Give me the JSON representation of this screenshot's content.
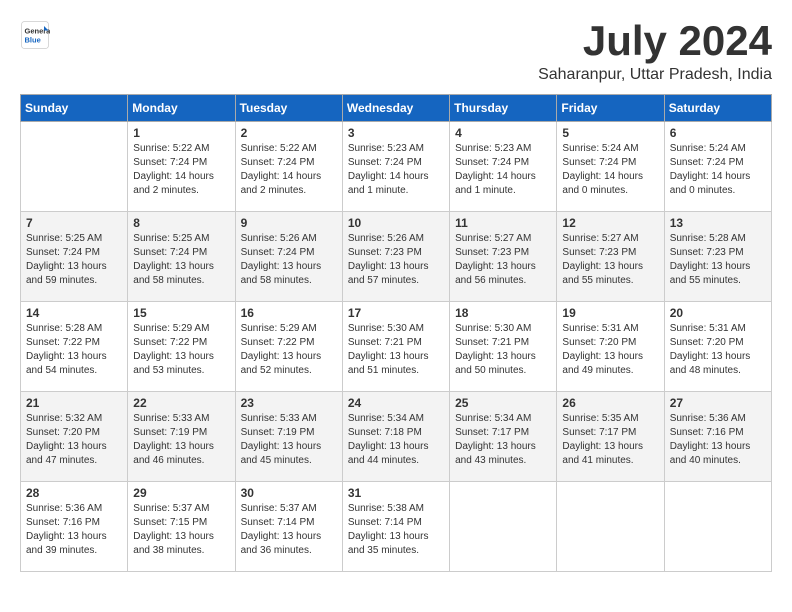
{
  "header": {
    "logo_general": "General",
    "logo_blue": "Blue",
    "month_title": "July 2024",
    "location": "Saharanpur, Uttar Pradesh, India"
  },
  "columns": [
    "Sunday",
    "Monday",
    "Tuesday",
    "Wednesday",
    "Thursday",
    "Friday",
    "Saturday"
  ],
  "weeks": [
    [
      {
        "day": "",
        "info": ""
      },
      {
        "day": "1",
        "info": "Sunrise: 5:22 AM\nSunset: 7:24 PM\nDaylight: 14 hours\nand 2 minutes."
      },
      {
        "day": "2",
        "info": "Sunrise: 5:22 AM\nSunset: 7:24 PM\nDaylight: 14 hours\nand 2 minutes."
      },
      {
        "day": "3",
        "info": "Sunrise: 5:23 AM\nSunset: 7:24 PM\nDaylight: 14 hours\nand 1 minute."
      },
      {
        "day": "4",
        "info": "Sunrise: 5:23 AM\nSunset: 7:24 PM\nDaylight: 14 hours\nand 1 minute."
      },
      {
        "day": "5",
        "info": "Sunrise: 5:24 AM\nSunset: 7:24 PM\nDaylight: 14 hours\nand 0 minutes."
      },
      {
        "day": "6",
        "info": "Sunrise: 5:24 AM\nSunset: 7:24 PM\nDaylight: 14 hours\nand 0 minutes."
      }
    ],
    [
      {
        "day": "7",
        "info": "Sunrise: 5:25 AM\nSunset: 7:24 PM\nDaylight: 13 hours\nand 59 minutes."
      },
      {
        "day": "8",
        "info": "Sunrise: 5:25 AM\nSunset: 7:24 PM\nDaylight: 13 hours\nand 58 minutes."
      },
      {
        "day": "9",
        "info": "Sunrise: 5:26 AM\nSunset: 7:24 PM\nDaylight: 13 hours\nand 58 minutes."
      },
      {
        "day": "10",
        "info": "Sunrise: 5:26 AM\nSunset: 7:23 PM\nDaylight: 13 hours\nand 57 minutes."
      },
      {
        "day": "11",
        "info": "Sunrise: 5:27 AM\nSunset: 7:23 PM\nDaylight: 13 hours\nand 56 minutes."
      },
      {
        "day": "12",
        "info": "Sunrise: 5:27 AM\nSunset: 7:23 PM\nDaylight: 13 hours\nand 55 minutes."
      },
      {
        "day": "13",
        "info": "Sunrise: 5:28 AM\nSunset: 7:23 PM\nDaylight: 13 hours\nand 55 minutes."
      }
    ],
    [
      {
        "day": "14",
        "info": "Sunrise: 5:28 AM\nSunset: 7:22 PM\nDaylight: 13 hours\nand 54 minutes."
      },
      {
        "day": "15",
        "info": "Sunrise: 5:29 AM\nSunset: 7:22 PM\nDaylight: 13 hours\nand 53 minutes."
      },
      {
        "day": "16",
        "info": "Sunrise: 5:29 AM\nSunset: 7:22 PM\nDaylight: 13 hours\nand 52 minutes."
      },
      {
        "day": "17",
        "info": "Sunrise: 5:30 AM\nSunset: 7:21 PM\nDaylight: 13 hours\nand 51 minutes."
      },
      {
        "day": "18",
        "info": "Sunrise: 5:30 AM\nSunset: 7:21 PM\nDaylight: 13 hours\nand 50 minutes."
      },
      {
        "day": "19",
        "info": "Sunrise: 5:31 AM\nSunset: 7:20 PM\nDaylight: 13 hours\nand 49 minutes."
      },
      {
        "day": "20",
        "info": "Sunrise: 5:31 AM\nSunset: 7:20 PM\nDaylight: 13 hours\nand 48 minutes."
      }
    ],
    [
      {
        "day": "21",
        "info": "Sunrise: 5:32 AM\nSunset: 7:20 PM\nDaylight: 13 hours\nand 47 minutes."
      },
      {
        "day": "22",
        "info": "Sunrise: 5:33 AM\nSunset: 7:19 PM\nDaylight: 13 hours\nand 46 minutes."
      },
      {
        "day": "23",
        "info": "Sunrise: 5:33 AM\nSunset: 7:19 PM\nDaylight: 13 hours\nand 45 minutes."
      },
      {
        "day": "24",
        "info": "Sunrise: 5:34 AM\nSunset: 7:18 PM\nDaylight: 13 hours\nand 44 minutes."
      },
      {
        "day": "25",
        "info": "Sunrise: 5:34 AM\nSunset: 7:17 PM\nDaylight: 13 hours\nand 43 minutes."
      },
      {
        "day": "26",
        "info": "Sunrise: 5:35 AM\nSunset: 7:17 PM\nDaylight: 13 hours\nand 41 minutes."
      },
      {
        "day": "27",
        "info": "Sunrise: 5:36 AM\nSunset: 7:16 PM\nDaylight: 13 hours\nand 40 minutes."
      }
    ],
    [
      {
        "day": "28",
        "info": "Sunrise: 5:36 AM\nSunset: 7:16 PM\nDaylight: 13 hours\nand 39 minutes."
      },
      {
        "day": "29",
        "info": "Sunrise: 5:37 AM\nSunset: 7:15 PM\nDaylight: 13 hours\nand 38 minutes."
      },
      {
        "day": "30",
        "info": "Sunrise: 5:37 AM\nSunset: 7:14 PM\nDaylight: 13 hours\nand 36 minutes."
      },
      {
        "day": "31",
        "info": "Sunrise: 5:38 AM\nSunset: 7:14 PM\nDaylight: 13 hours\nand 35 minutes."
      },
      {
        "day": "",
        "info": ""
      },
      {
        "day": "",
        "info": ""
      },
      {
        "day": "",
        "info": ""
      }
    ]
  ]
}
